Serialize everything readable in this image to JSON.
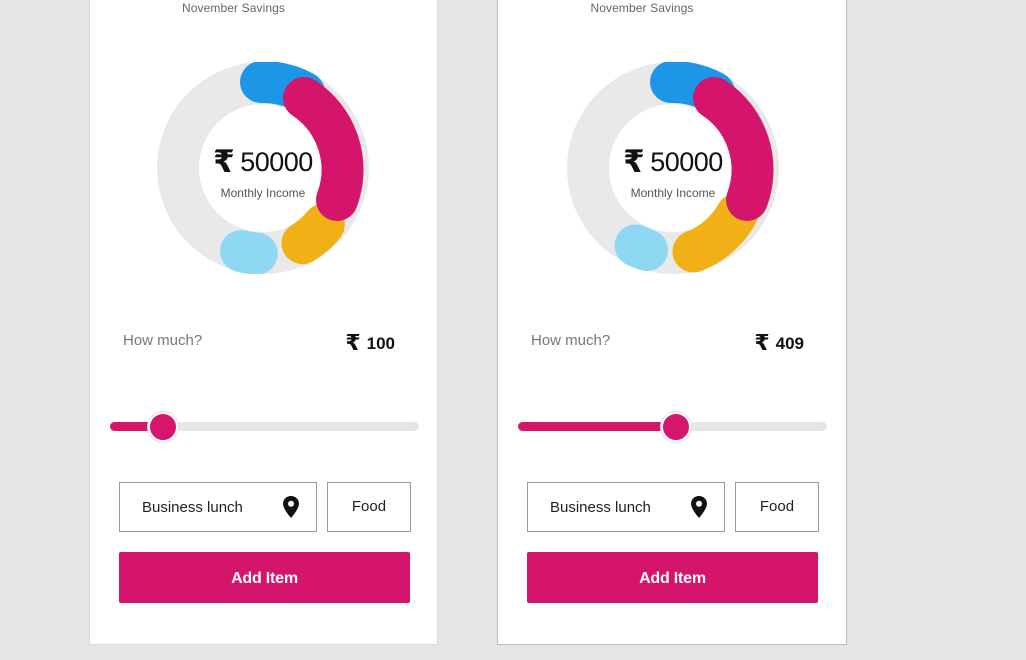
{
  "cards": [
    {
      "subtitle": "November Savings",
      "currency_symbol": "₹",
      "income_amount": "50000",
      "income_label": "Monthly Income",
      "how_much_label": "How much?",
      "amount_value": "100",
      "slider_fraction": 0.17,
      "item_field_value": "Business lunch",
      "category_value": "Food",
      "add_button_label": "Add Item"
    },
    {
      "subtitle": "November Savings",
      "currency_symbol": "₹",
      "income_amount": "50000",
      "income_label": "Monthly Income",
      "how_much_label": "How much?",
      "amount_value": "409",
      "slider_fraction": 0.51,
      "item_field_value": "Business lunch",
      "category_value": "Food",
      "add_button_label": "Add Item"
    }
  ],
  "colors": {
    "accent": "#d4156b",
    "blue": "#1e96e8",
    "light_blue": "#8ed8f4",
    "yellow": "#f0b016",
    "ring_bg": "#e9e9e9"
  },
  "icons": {
    "location": "location-pin-icon"
  }
}
